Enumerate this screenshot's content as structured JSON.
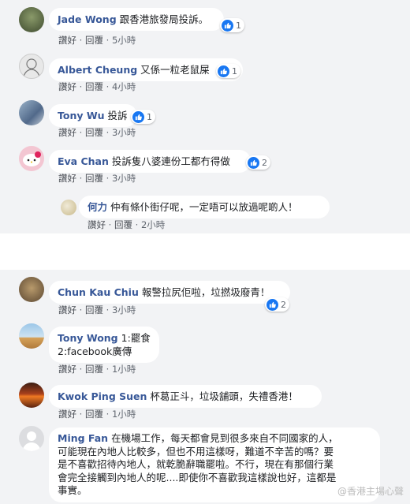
{
  "actions": {
    "like": "讚好",
    "reply": "回覆",
    "sep": "·"
  },
  "comments": [
    {
      "name": "Jade Wong",
      "text": "跟香港旅發局投訴。",
      "reactions": "1",
      "time": "5小時"
    },
    {
      "name": "Albert Cheung",
      "text": "又係一粒老鼠屎",
      "reactions": "1",
      "time": "4小時"
    },
    {
      "name": "Tony Wu",
      "text": "投訴",
      "reactions": "1",
      "time": "3小時"
    },
    {
      "name": "Eva Chan",
      "text": "投訴隻八婆連份工都冇得做",
      "reactions": "2",
      "time": "3小時"
    },
    {
      "name": "何力",
      "text": "仲有條仆街仔呢，一定唔可以放過呢啲人！",
      "time": "2小時"
    },
    {
      "name": "Chun Kau Chiu",
      "text": "報警拉尻佢啦，垃撚圾廢青！",
      "reactions": "2",
      "time": "3小時"
    },
    {
      "name": "Tony Wong",
      "text_line1": "1:罷食",
      "text_line2": "2:facebook廣傳",
      "time": "1小時"
    },
    {
      "name": "Kwok Ping Suen",
      "text": "杯葛正斗，垃圾舖頭，失禮香港！",
      "time": "1小時"
    },
    {
      "name": "Ming Fan",
      "text_line1": "在機場工作，每天都會見到很多來自不同國家的人，",
      "text_line2": "可能現在內地人比較多，但也不用這樣呀，難道不辛苦的嗎？要",
      "text_line3": "是不喜歡招待內地人，就乾脆辭職罷啦。不行，現在有那個行業",
      "text_line4": "會完全接觸到內地人的呢....即使你不喜歡我這樣說也好，這都是",
      "text_line5": "事實。"
    }
  ],
  "watermark": "@香港主場心聲"
}
